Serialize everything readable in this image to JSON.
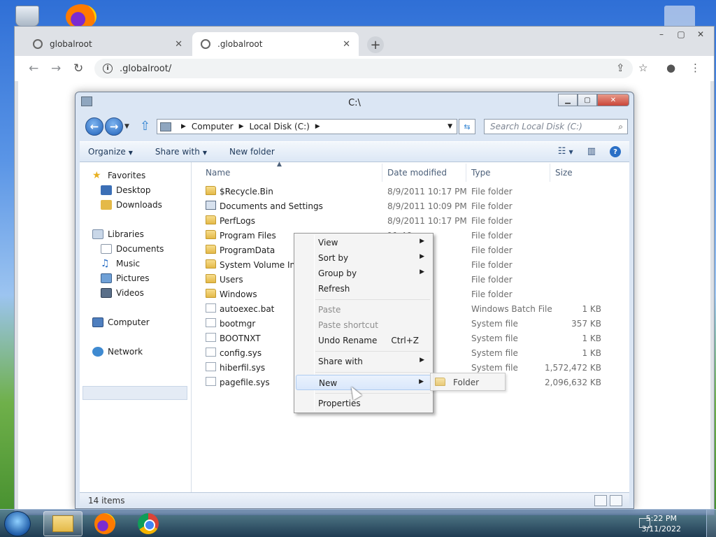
{
  "chrome": {
    "tabs": [
      {
        "label": "globalroot"
      },
      {
        "label": ".globalroot"
      }
    ],
    "new_tab": "+",
    "address": ".globalroot/",
    "controls": {
      "min": "–",
      "max": "▢",
      "close": "✕"
    }
  },
  "explorer": {
    "title": "C:\\",
    "breadcrumb": [
      "Computer",
      "Local Disk (C:)"
    ],
    "search_placeholder": "Search Local Disk (C:)",
    "commands": {
      "organize": "Organize",
      "share_with": "Share with",
      "new_folder": "New folder"
    },
    "nav_pane": {
      "favorites": "Favorites",
      "desktop": "Desktop",
      "downloads": "Downloads",
      "libraries": "Libraries",
      "documents": "Documents",
      "music": "Music",
      "pictures": "Pictures",
      "videos": "Videos",
      "computer": "Computer",
      "network": "Network"
    },
    "columns": {
      "name": "Name",
      "date": "Date modified",
      "type": "Type",
      "size": "Size"
    },
    "files": [
      {
        "name": "$Recycle.Bin",
        "date": "8/9/2011 10:17 PM",
        "type": "File folder",
        "size": "",
        "kind": "folder"
      },
      {
        "name": "Documents and Settings",
        "date": "8/9/2011 10:09 PM",
        "type": "File folder",
        "size": "",
        "kind": "shortcut"
      },
      {
        "name": "PerfLogs",
        "date": "8/9/2011 10:17 PM",
        "type": "File folder",
        "size": "",
        "kind": "folder"
      },
      {
        "name": "Program Files",
        "date": "11:46 ...",
        "type": "File folder",
        "size": "",
        "kind": "folder"
      },
      {
        "name": "ProgramData",
        "date": "1:31 ...",
        "type": "File folder",
        "size": "",
        "kind": "folder"
      },
      {
        "name": "System Volume Info",
        "date": "40 AM",
        "type": "File folder",
        "size": "",
        "kind": "folder"
      },
      {
        "name": "Users",
        "date": "0:47 ...",
        "type": "File folder",
        "size": "",
        "kind": "folder"
      },
      {
        "name": "Windows",
        "date": "1:43 ...",
        "type": "File folder",
        "size": "",
        "kind": "folder"
      },
      {
        "name": "autoexec.bat",
        "date": "53 PM",
        "type": "Windows Batch File",
        "size": "1 KB",
        "kind": "file"
      },
      {
        "name": "bootmgr",
        "date": "50 AM",
        "type": "System file",
        "size": "357 KB",
        "kind": "file"
      },
      {
        "name": "BOOTNXT",
        "date": "1 AM",
        "type": "System file",
        "size": "1 KB",
        "kind": "file"
      },
      {
        "name": "config.sys",
        "date": "53 PM",
        "type": "System file",
        "size": "1 KB",
        "kind": "file"
      },
      {
        "name": "hiberfil.sys",
        "date": "18 PM",
        "type": "System file",
        "size": "1,572,472 KB",
        "kind": "file"
      },
      {
        "name": "pagefile.sys",
        "date": "",
        "type": "",
        "size": "2,096,632 KB",
        "kind": "file"
      }
    ],
    "status": "14 items"
  },
  "context_menu": {
    "view": "View",
    "sort_by": "Sort by",
    "group_by": "Group by",
    "refresh": "Refresh",
    "paste": "Paste",
    "paste_shortcut": "Paste shortcut",
    "undo_rename": "Undo Rename",
    "undo_shortcut": "Ctrl+Z",
    "share_with": "Share with",
    "new": "New",
    "properties": "Properties",
    "submenu_folder": "Folder"
  },
  "taskbar": {
    "time": "5:22 PM",
    "date": "3/11/2022"
  }
}
